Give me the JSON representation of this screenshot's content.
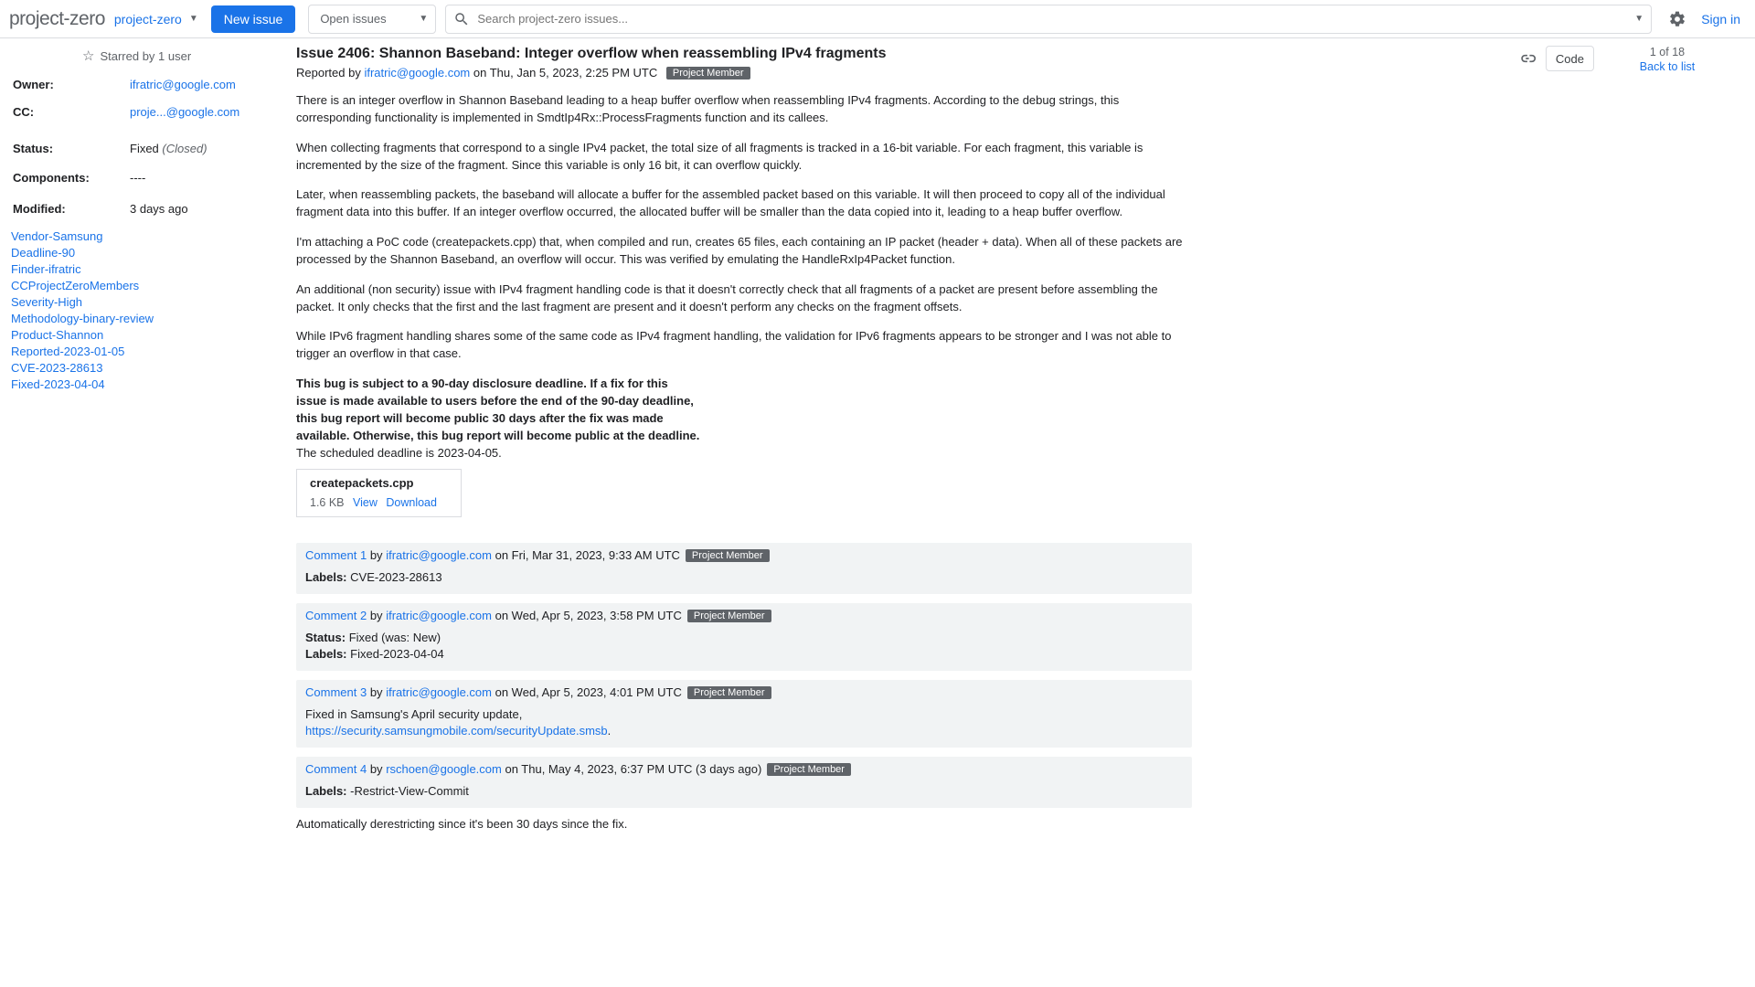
{
  "topbar": {
    "logo": "project-zero",
    "crumb": "project-zero",
    "new_issue": "New issue",
    "scope": "Open issues",
    "search_placeholder": "Search project-zero issues...",
    "sign_in": "Sign in"
  },
  "nav": {
    "pagination": "1 of 18",
    "back": "Back to list"
  },
  "sidebar": {
    "starred": "Starred by 1 user",
    "owner_k": "Owner:",
    "owner_v": "ifratric@google.com",
    "cc_k": "CC:",
    "cc_v": "proje...@google.com",
    "status_k": "Status:",
    "status_v": "Fixed",
    "status_closed": "(Closed)",
    "components_k": "Components:",
    "components_v": "----",
    "modified_k": "Modified:",
    "modified_v": "3 days ago",
    "labels": [
      "Vendor-Samsung",
      "Deadline-90",
      "Finder-ifratric",
      "CCProjectZeroMembers",
      "Severity-High",
      "Methodology-binary-review",
      "Product-Shannon",
      "Reported-2023-01-05",
      "CVE-2023-28613",
      "Fixed-2023-04-04"
    ]
  },
  "issue": {
    "title": "Issue 2406: Shannon Baseband: Integer overflow when reassembling IPv4 fragments",
    "reported_prefix": "Reported by",
    "reporter": "ifratric@google.com",
    "reported_on": "on Thu, Jan 5, 2023, 2:25 PM UTC",
    "badge": "Project Member",
    "code_btn": "Code"
  },
  "desc": {
    "p1": "There is an integer overflow in Shannon Baseband leading to a heap buffer overflow when reassembling IPv4 fragments. According to the debug strings, this corresponding functionality is implemented in SmdtIp4Rx::ProcessFragments function and its callees.",
    "p2": "When collecting fragments that correspond to a single IPv4 packet, the total size of all fragments is tracked in a 16-bit variable. For each fragment, this variable is incremented by the size of the fragment. Since this variable is only 16 bit, it can overflow quickly.",
    "p3": "Later, when reassembling packets, the baseband will allocate a buffer for the assembled packet based on this variable. It will then proceed to copy all of the individual fragment data into this buffer. If an integer overflow occurred, the allocated buffer will be smaller than the data copied into it, leading to a heap buffer overflow.",
    "p4": "I'm attaching a PoC code (createpackets.cpp) that, when compiled and run, creates 65 files, each containing an IP packet (header + data). When all of these packets are processed by the Shannon Baseband, an overflow will occur. This was verified by emulating the HandleRxIp4Packet function.",
    "p5": "An additional (non security) issue with IPv4 fragment handling code is that it doesn't correctly check that all fragments of a packet are present before assembling the packet. It only checks that the first and the last fragment are present and it doesn't perform any checks on the fragment offsets.",
    "p6": "While IPv6 fragment handling shares some of the same code as IPv4 fragment handling, the validation for IPv6 fragments appears to be stronger and I was not able to trigger an overflow in that case.",
    "b1": "This bug is subject to a 90-day disclosure deadline. If a fix for this",
    "b2": "issue is made available to users before the end of the 90-day deadline,",
    "b3": "this bug report will become public 30 days after the fix was made",
    "b4": "available. Otherwise, this bug report will become public at the deadline.",
    "b5": "The scheduled deadline is 2023-04-05.",
    "attach_name": "createpackets.cpp",
    "attach_size": "1.6 KB",
    "attach_view": "View",
    "attach_dl": "Download"
  },
  "comments": [
    {
      "num": "Comment 1",
      "by_word": "by",
      "author": "ifratric@google.com",
      "on": "on Fri, Mar 31, 2023, 9:33 AM UTC",
      "badge": "Project Member",
      "rows": [
        {
          "k": "Labels:",
          "v": "CVE-2023-28613"
        }
      ]
    },
    {
      "num": "Comment 2",
      "by_word": "by",
      "author": "ifratric@google.com",
      "on": "on Wed, Apr 5, 2023, 3:58 PM UTC",
      "badge": "Project Member",
      "rows": [
        {
          "k": "Status:",
          "v": "Fixed (was: New)"
        },
        {
          "k": "Labels:",
          "v": "Fixed-2023-04-04"
        }
      ]
    },
    {
      "num": "Comment 3",
      "by_word": "by",
      "author": "ifratric@google.com",
      "on": "on Wed, Apr 5, 2023, 4:01 PM UTC",
      "badge": "Project Member",
      "body_pre": "Fixed in Samsung's April security update,",
      "body_link": "https://security.samsungmobile.com/securityUpdate.smsb",
      "body_post": "."
    },
    {
      "num": "Comment 4",
      "by_word": "by",
      "author": "rschoen@google.com",
      "on": "on Thu, May 4, 2023, 6:37 PM UTC (3 days ago)",
      "badge": "Project Member",
      "rows": [
        {
          "k": "Labels:",
          "v": "-Restrict-View-Commit"
        }
      ],
      "after": "Automatically derestricting since it's been 30 days since the fix."
    }
  ]
}
